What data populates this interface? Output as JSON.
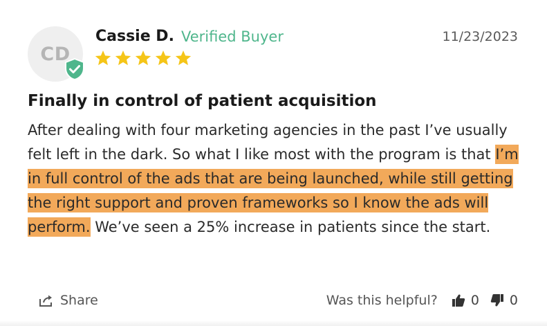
{
  "reviewer": {
    "initials": "CD",
    "name": "Cassie D.",
    "badge": "Verified Buyer",
    "date": "11/23/2023",
    "rating": 5
  },
  "review": {
    "title": "Finally in control of patient acquisition",
    "body_before": "After dealing with four marketing agencies in the past I’ve usually felt left in the dark. So what I like most with the program is that ",
    "body_highlight": "I’m in full control of the ads that are being launched, while still getting the right support and proven frameworks so I know the ads will perform.",
    "body_after": " We’ve seen a 25% increase in patients since the start."
  },
  "footer": {
    "share_label": "Share",
    "helpful_label": "Was this helpful?",
    "upvotes": "0",
    "downvotes": "0"
  },
  "colors": {
    "star": "#f5c518",
    "verified": "#4fb68c",
    "highlight": "#f2a95a"
  },
  "icons": [
    "verified-shield-icon",
    "star-icon",
    "share-icon",
    "thumbs-up-icon",
    "thumbs-down-icon"
  ]
}
